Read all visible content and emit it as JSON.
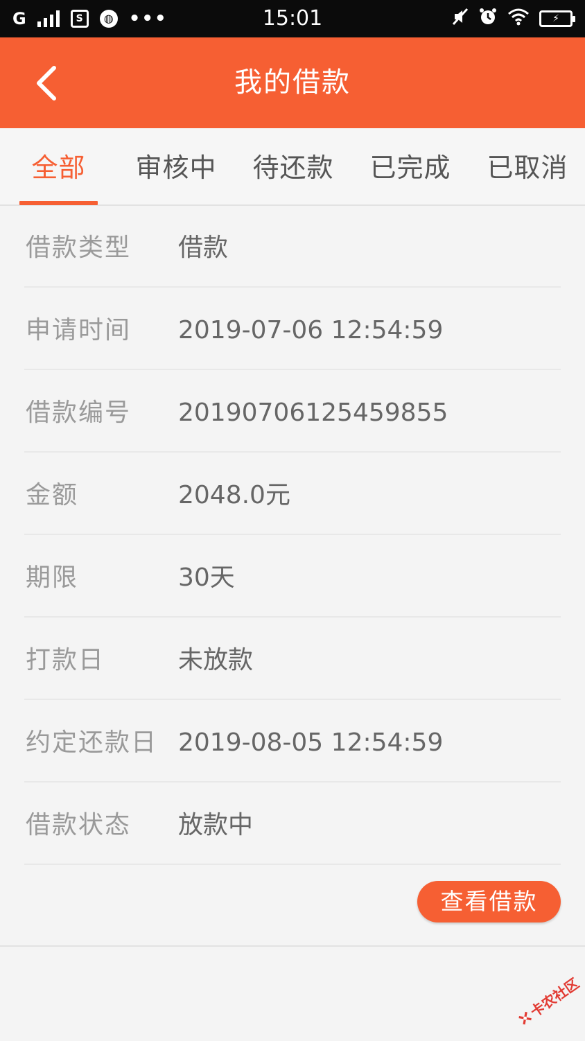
{
  "status_bar": {
    "carrier": "G",
    "time": "15:01",
    "icons": [
      "signal-icon",
      "screenshot-icon",
      "globe-icon",
      "more-dots-icon",
      "mute-icon",
      "alarm-icon",
      "wifi-icon",
      "battery-charging-icon"
    ]
  },
  "header": {
    "title": "我的借款",
    "back_icon": "chevron-left-icon",
    "background": "#f65f33"
  },
  "tabs": [
    {
      "label": "全部",
      "active": true
    },
    {
      "label": "审核中",
      "active": false
    },
    {
      "label": "待还款",
      "active": false
    },
    {
      "label": "已完成",
      "active": false
    },
    {
      "label": "已取消",
      "active": false
    }
  ],
  "loan": {
    "rows": [
      {
        "label": "借款类型",
        "value": "借款"
      },
      {
        "label": "申请时间",
        "value": "2019-07-06 12:54:59"
      },
      {
        "label": "借款编号",
        "value": "20190706125459855"
      },
      {
        "label": "金额",
        "value": "2048.0元"
      },
      {
        "label": "期限",
        "value": "30天"
      },
      {
        "label": "打款日",
        "value": "未放款"
      },
      {
        "label": "约定还款日",
        "value": "2019-08-05 12:54:59"
      },
      {
        "label": "借款状态",
        "value": "放款中"
      }
    ],
    "view_button_label": "查看借款"
  },
  "watermark": {
    "text": "卡农社区"
  },
  "colors": {
    "accent": "#f65f33",
    "label_text": "#9a9a9a",
    "value_text": "#666666",
    "background": "#f4f4f4"
  }
}
